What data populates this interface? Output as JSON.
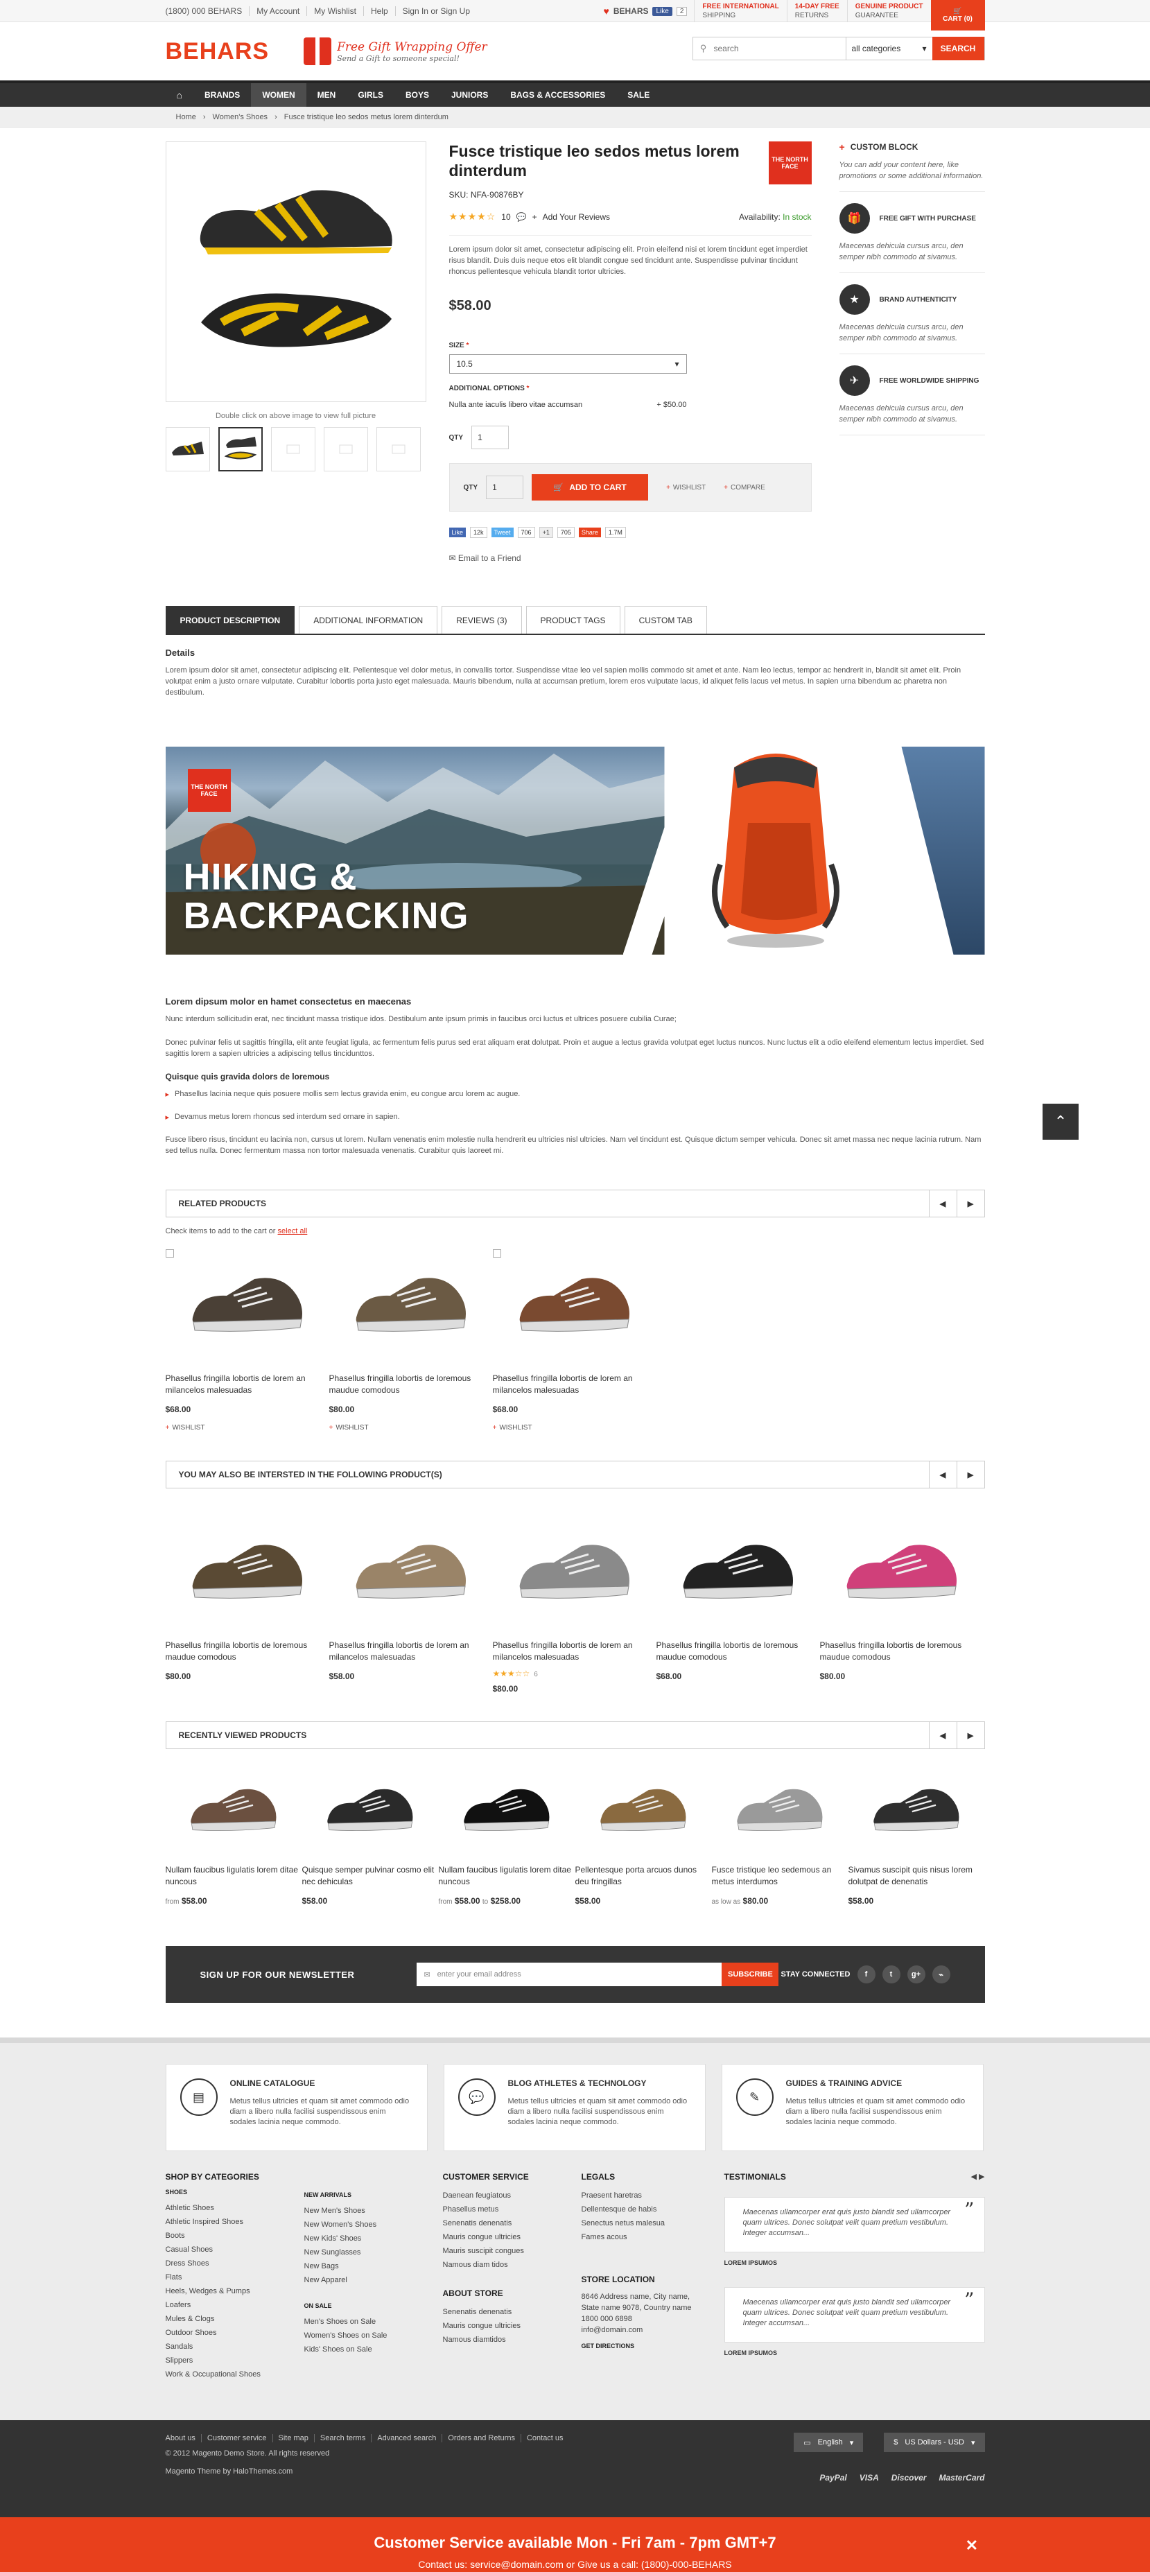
{
  "topbar": {
    "phone": "(1800) 000 BEHARS",
    "links": [
      "My Account",
      "My Wishlist",
      "Help",
      "Sign In or Sign Up"
    ],
    "brand": "BEHARS",
    "fb_like": "Like",
    "fb_count": "2",
    "promos": [
      {
        "title": "FREE INTERNATIONAL",
        "sub": "SHIPPING"
      },
      {
        "title": "14-DAY FREE",
        "sub": "RETURNS"
      },
      {
        "title": "GENUINE PRODUCT",
        "sub": "GUARANTEE"
      }
    ],
    "cart_label": "CART (0)"
  },
  "header": {
    "logo": "BEHARS",
    "gift_title": "Free Gift Wrapping Offer",
    "gift_sub": "Send a Gift to someone special!",
    "search_placeholder": "search",
    "search_category": "all categories",
    "search_button": "SEARCH"
  },
  "nav": [
    "BRANDS",
    "WOMEN",
    "MEN",
    "GIRLS",
    "BOYS",
    "JUNIORS",
    "BAGS & ACCESSORIES",
    "SALE"
  ],
  "breadcrumb": [
    "Home",
    "Women's Shoes",
    "Fusce tristique leo sedos metus lorem dinterdum"
  ],
  "product": {
    "title": "Fusce tristique leo sedos metus lorem dinterdum",
    "brand_logo": "THE NORTH FACE",
    "sku": "SKU: NFA-90876BY",
    "stars": "★★★★☆",
    "review_count": "10",
    "add_review": "Add Your Reviews",
    "availability_label": "Availability:",
    "availability": "In stock",
    "description": "Lorem ipsum dolor sit amet, consectetur adipiscing elit. Proin eleifend nisi et lorem tincidunt eget imperdiet risus blandit. Duis duis neque etos elit blandit congue sed tincidunt ante. Suspendisse pulvinar tincidunt rhoncus pellentesque vehicula blandit tortor ultricies.",
    "price": "$58.00",
    "size_label": "SIZE",
    "size_value": "10.5",
    "additional_label": "ADDITIONAL OPTIONS",
    "additional_option": "Nulla ante iaculis libero vitae accumsan",
    "additional_price": "+ $50.00",
    "qty_label": "QTY",
    "qty": "1",
    "add_to_cart": "ADD TO CART",
    "wishlist": "WISHLIST",
    "compare": "COMPARE",
    "gallery_hint": "Double click on above image to view full picture",
    "email_friend": "Email to a Friend",
    "social": {
      "like": "Like",
      "like_count": "12k",
      "tweet": "Tweet",
      "tweet_count": "706",
      "gplus": "+1",
      "gplus_count": "705",
      "share": "Share",
      "share_count": "1.7M"
    }
  },
  "sidebar": {
    "custom_title": "CUSTOM BLOCK",
    "custom_text": "You can add your content here, like promotions or some additional information.",
    "items": [
      {
        "title": "FREE GIFT WITH PURCHASE",
        "text": "Maecenas dehicula cursus arcu, den semper nibh commodo at sivamus."
      },
      {
        "title": "BRAND AUTHENTICITY",
        "text": "Maecenas dehicula cursus arcu, den semper nibh commodo at sivamus."
      },
      {
        "title": "FREE WORLDWIDE SHIPPING",
        "text": "Maecenas dehicula cursus arcu, den semper nibh commodo at sivamus."
      }
    ]
  },
  "tabs": [
    "PRODUCT DESCRIPTION",
    "ADDITIONAL INFORMATION",
    "REVIEWS (3)",
    "PRODUCT TAGS",
    "CUSTOM TAB"
  ],
  "details": {
    "heading": "Details",
    "text": "Lorem ipsum dolor sit amet, consectetur adipiscing elit. Pellentesque vel dolor metus, in convallis tortor. Suspendisse vitae leo vel sapien mollis commodo sit amet et ante. Nam leo lectus, tempor ac hendrerit in, blandit sit amet elit. Proin volutpat enim a justo ornare vulputate. Curabitur lobortis porta justo eget malesuada. Mauris bibendum, nulla at accumsan pretium, lorem eros vulputate lacus, id aliquet felis lacus vel metus. In sapien urna bibendum ac pharetra non destibulum.",
    "banner_logo": "THE NORTH FACE",
    "banner_title_1": "HIKING &",
    "banner_title_2": "BACKPACKING",
    "h3": "Lorem dipsum molor en hamet consectetus en maecenas",
    "p1": "Nunc interdum sollicitudin erat, nec tincidunt massa tristique idos. Destibulum ante ipsum primis in faucibus orci luctus et ultrices posuere cubilia Curae;",
    "p2": "Donec pulvinar felis ut sagittis fringilla, elit ante feugiat ligula, ac fermentum felis purus sed erat aliquam erat dolutpat. Proin et augue a lectus gravida volutpat eget luctus nuncos. Nunc luctus elit a odio eleifend elementum lectus imperdiet. Sed sagittis lorem a sapien ultricies a adipiscing tellus tincidunttos.",
    "h4": "Quisque quis gravida dolors de loremous",
    "bullets": [
      "Phasellus lacinia neque quis posuere mollis sem lectus gravida enim, eu congue arcu lorem ac augue.",
      "Devamus metus lorem rhoncus sed interdum sed ornare in sapien."
    ],
    "p3": "Fusce libero risus, tincidunt eu lacinia non, cursus ut lorem. Nullam venenatis enim molestie nulla hendrerit eu ultricies nisl ultricies. Nam vel tincidunt est. Quisque dictum semper vehicula. Donec sit amet massa nec neque lacinia rutrum. Nam sed tellus nulla. Donec fermentum massa non tortor malesuada venenatis. Curabitur quis laoreet mi."
  },
  "related": {
    "title": "RELATED PRODUCTS",
    "hint": "Check items to add to the cart or",
    "select_all": "select all",
    "items": [
      {
        "name": "Phasellus fringilla lobortis de lorem an milancelos malesuadas",
        "price": "$68.00",
        "wishlist": "WISHLIST",
        "color": "#4a4036"
      },
      {
        "name": "Phasellus fringilla lobortis de loremous maudue comodous",
        "price": "$80.00",
        "wishlist": "WISHLIST",
        "color": "#6b5a44"
      },
      {
        "name": "Phasellus fringilla lobortis de lorem an milancelos malesuadas",
        "price": "$68.00",
        "wishlist": "WISHLIST",
        "color": "#7a4a30"
      }
    ]
  },
  "interested": {
    "title": "YOU MAY ALSO BE INTERSTED IN THE FOLLOWING PRODUCT(S)",
    "items": [
      {
        "name": "Phasellus fringilla lobortis de loremous maudue comodous",
        "price": "$80.00",
        "color": "#5a4a34"
      },
      {
        "name": "Phasellus fringilla lobortis de lorem an milancelos malesuadas",
        "price": "$58.00",
        "color": "#9a8468"
      },
      {
        "name": "Phasellus fringilla lobortis de lorem an milancelos malesuadas",
        "price": "$80.00",
        "color": "#8a8a8a",
        "stars": "★★★☆☆",
        "count": "6"
      },
      {
        "name": "Phasellus fringilla lobortis de loremous maudue comodous",
        "price": "$68.00",
        "color": "#222222"
      },
      {
        "name": "Phasellus fringilla lobortis de loremous maudue comodous",
        "price": "$80.00",
        "color": "#d0407a"
      }
    ]
  },
  "recent": {
    "title": "RECENTLY VIEWED PRODUCTS",
    "items": [
      {
        "name": "Nullam faucibus ligulatis lorem ditae nuncous",
        "from": "from",
        "price": "$58.00",
        "to": "",
        "price2": "",
        "color": "#6b5040"
      },
      {
        "name": "Quisque semper pulvinar cosmo elit nec dehiculas",
        "from": "",
        "price": "$58.00",
        "to": "",
        "price2": "",
        "color": "#2a2a2a"
      },
      {
        "name": "Nullam faucibus ligulatis lorem ditae nuncous",
        "from": "from",
        "price": "$58.00",
        "to": "to",
        "price2": "$258.00",
        "color": "#111111"
      },
      {
        "name": "Pellentesque porta arcuos dunos deu fringillas",
        "from": "",
        "price": "$58.00",
        "to": "",
        "price2": "",
        "color": "#8a6a40"
      },
      {
        "name": "Fusce tristique leo sedemous an metus interdumos",
        "from": "as low as",
        "price": "$80.00",
        "to": "",
        "price2": "",
        "color": "#9a9a9a"
      },
      {
        "name": "Sivamus suscipit quis nisus lorem dolutpat de denenatis",
        "from": "",
        "price": "$58.00",
        "to": "",
        "price2": "",
        "color": "#2e2e2e"
      }
    ]
  },
  "newsletter": {
    "title": "SIGN UP FOR OUR NEWSLETTER",
    "placeholder": "enter your email address",
    "button": "SUBSCRIBE",
    "stay": "STAY CONNECTED"
  },
  "footer_boxes": [
    {
      "title": "ONLINE CATALOGUE",
      "text": "Metus tellus ultricies et quam sit amet commodo odio diam a libero nulla facilisi suspendissous enim sodales lacinia neque commodo."
    },
    {
      "title": "BLOG ATHLETES & TECHNOLOGY",
      "text": "Metus tellus ultricies et quam sit amet commodo odio diam a libero nulla facilisi suspendissous enim sodales lacinia neque commodo."
    },
    {
      "title": "GUIDES & TRAINING ADVICE",
      "text": "Metus tellus ultricies et quam sit amet commodo odio diam a libero nulla facilisi suspendissous enim sodales lacinia neque commodo."
    }
  ],
  "footer": {
    "cat_title": "SHOP BY CATEGORIES",
    "shoes_title": "SHOES",
    "shoes": [
      "Athletic Shoes",
      "Athletic Inspired Shoes",
      "Boots",
      "Casual Shoes",
      "Dress Shoes",
      "Flats",
      "Heels, Wedges & Pumps",
      "Loafers",
      "Mules & Clogs",
      "Outdoor Shoes",
      "Sandals",
      "Slippers",
      "Work & Occupational Shoes"
    ],
    "new_title": "NEW ARRIVALS",
    "new_items": [
      "New Men's Shoes",
      "New Women's Shoes",
      "New Kids' Shoes",
      "New Sunglasses",
      "New Bags",
      "New Apparel"
    ],
    "sale_title": "ON SALE",
    "sale_items": [
      "Men's Shoes on Sale",
      "Women's Shoes on Sale",
      "Kids' Shoes on Sale"
    ],
    "cs_title": "CUSTOMER SERVICE",
    "cs_items": [
      "Daenean feugiatous",
      "Phasellus metus",
      "Senenatis denenatis",
      "Mauris congue ultricies",
      "Mauris suscipit congues",
      "Namous diam tidos"
    ],
    "about_title": "ABOUT STORE",
    "about_items": [
      "Senenatis denenatis",
      "Mauris congue ultricies",
      "Namous diamtidos"
    ],
    "legal_title": "LEGALS",
    "legal_items": [
      "Praesent haretras",
      "Dellentesque de habis",
      "Senectus netus malesua",
      "Fames acous"
    ],
    "store_title": "STORE LOCATION",
    "store_lines": [
      "8646 Address name, City name,",
      "State name 9078, Country name",
      "1800 000 6898",
      "info@domain.com"
    ],
    "directions": "GET DIRECTIONS",
    "testi_title": "TESTIMONIALS",
    "testimonials": [
      {
        "text": "Maecenas ullamcorper erat quis justo blandit sed ullamcorper quam ultrices. Donec solutpat velit quam pretium vestibulum. Integer accumsan...",
        "name": "LOREM IPSUMOS"
      },
      {
        "text": "Maecenas ullamcorper erat quis justo blandit sed ullamcorper quam ultrices. Donec solutpat velit quam pretium vestibulum. Integer accumsan...",
        "name": "LOREM IPSUMOS"
      }
    ]
  },
  "bottom": {
    "links": [
      "About us",
      "Customer service",
      "Site map",
      "Search terms",
      "Advanced search",
      "Orders and Returns",
      "Contact us"
    ],
    "copyright": "© 2012 Magento Demo Store. All rights reserved",
    "theme": "Magento Theme by HaloThemes.com",
    "language": "English",
    "currency": "US Dollars - USD",
    "payments": [
      "PayPal",
      "VISA",
      "Discover",
      "MasterCard"
    ]
  },
  "service_bar": {
    "title": "Customer Service available Mon - Fri 7am - 7pm GMT+7",
    "contact": "Contact us: service@domain.com or Give us a call: (1800)-000-BEHARS"
  },
  "colors": {
    "accent": "#e8401c",
    "dark": "#333333"
  }
}
